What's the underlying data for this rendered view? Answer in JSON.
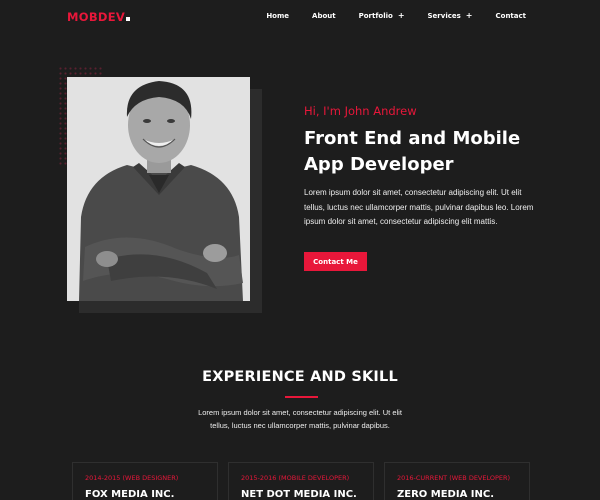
{
  "header": {
    "logo": "MOBDEV",
    "nav": [
      {
        "label": "Home"
      },
      {
        "label": "About"
      },
      {
        "label": "Portfolio",
        "icon": "plus-icon"
      },
      {
        "label": "Services",
        "icon": "plus-icon"
      },
      {
        "label": "Contact"
      }
    ]
  },
  "hero": {
    "greeting": "Hi, I'm John Andrew",
    "headline": "Front End and Mobile App Developer",
    "description": "Lorem ipsum dolor sit amet, consectetur adipiscing elit. Ut elit tellus, luctus nec ullamcorper mattis, pulvinar dapibus leo. Lorem ipsum dolor sit amet, consectetur adipiscing elit mattis.",
    "cta_label": "Contact Me",
    "photo": "portrait-photo"
  },
  "experience": {
    "title": "EXPERIENCE AND SKILL",
    "description": "Lorem ipsum dolor sit amet, consectetur adipiscing elit. Ut elit tellus, luctus nec ullamcorper mattis, pulvinar dapibus.",
    "cards": [
      {
        "period": "2014-2015 (WEB DESIGNER)",
        "company": "FOX MEDIA INC."
      },
      {
        "period": "2015-2016 (MOBILE DEVELOPER)",
        "company": "NET DOT MEDIA INC."
      },
      {
        "period": "2016-CURRENT (WEB DEVELOPER)",
        "company": "ZERO MEDIA INC."
      }
    ]
  },
  "colors": {
    "background": "#1d1d1d",
    "accent": "#e8173a",
    "text": "#ffffff"
  }
}
